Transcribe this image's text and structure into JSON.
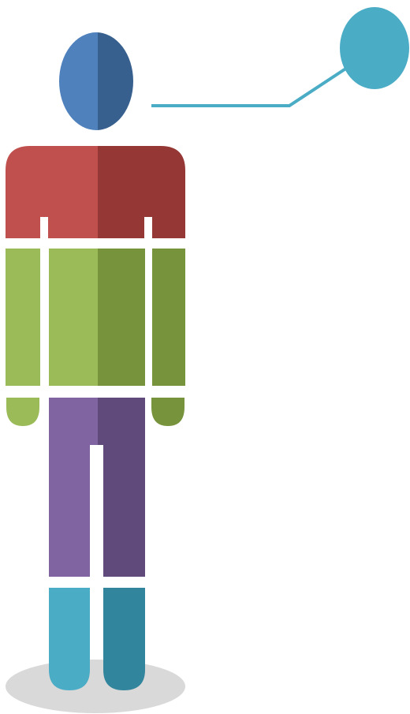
{
  "diagram": {
    "colors": {
      "head_light": "#4f81bd",
      "head_dark": "#37608f",
      "torso_light": "#c0504d",
      "torso_dark": "#953735",
      "arms_light": "#9bbb59",
      "arms_dark": "#77933c",
      "legs_light": "#8064a2",
      "legs_dark": "#604a7b",
      "feet_light": "#4bacc6",
      "feet_dark": "#31859c",
      "callout": "#4bacc6",
      "shadow": "#d9d9d9"
    },
    "icons": [
      "human-figure-icon",
      "callout-circle-icon"
    ]
  }
}
